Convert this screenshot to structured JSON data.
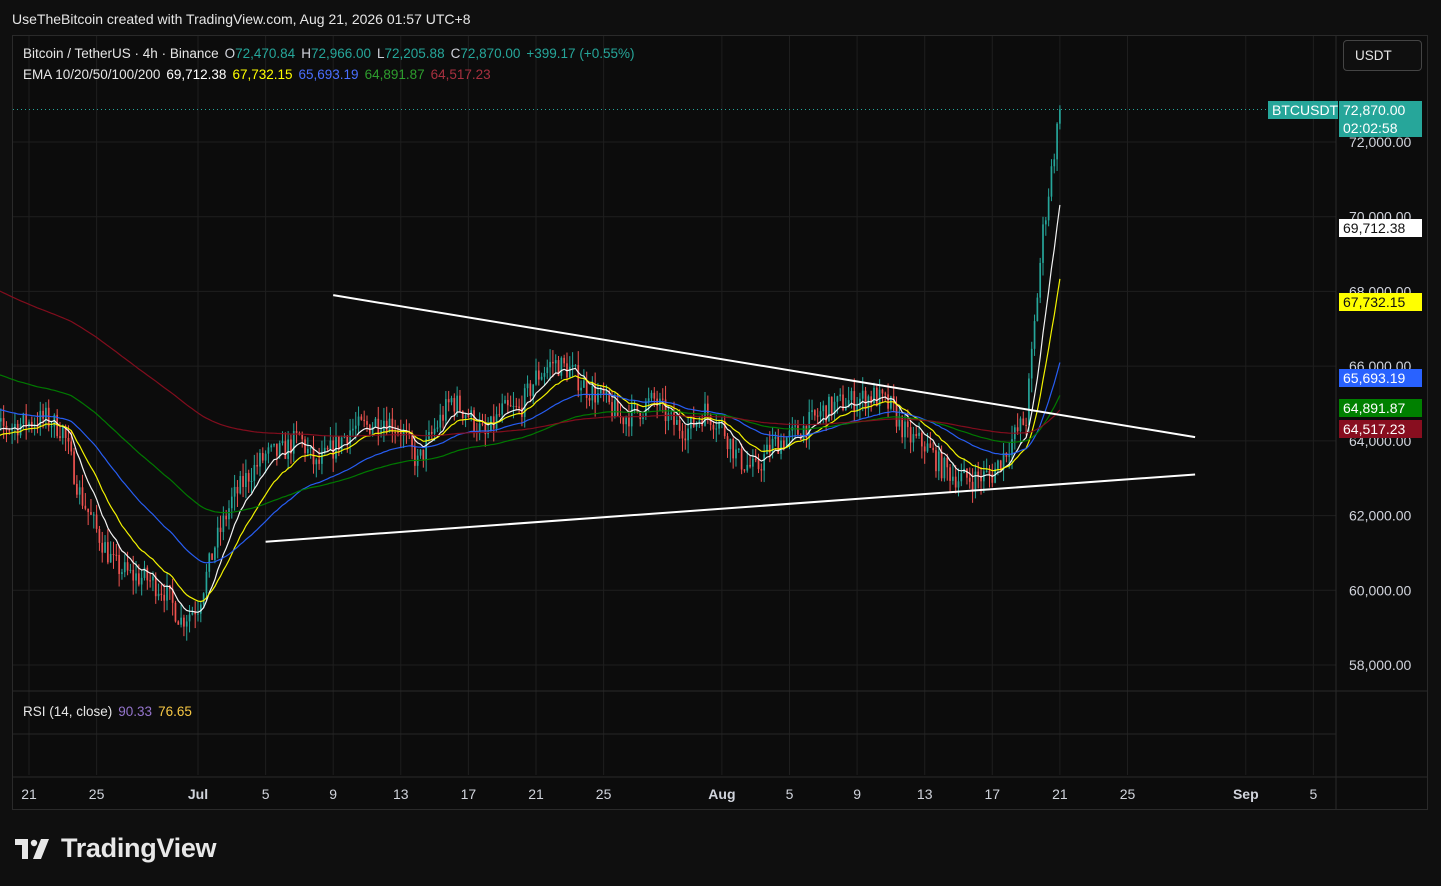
{
  "header": {
    "text": "UseTheBitcoin created with TradingView.com, Aug 21, 2026 01:57 UTC+8"
  },
  "legend": {
    "symbol": "Bitcoin / TetherUS · 4h · Binance",
    "o_label": "O",
    "o_value": "72,470.84",
    "h_label": "H",
    "h_value": "72,966.00",
    "l_label": "L",
    "l_value": "72,205.88",
    "c_label": "C",
    "c_value": "72,870.00",
    "change": "+399.17 (+0.55%)",
    "ema_label": "EMA 10/20/50/100/200",
    "ema_values": [
      "69,712.38",
      "67,732.15",
      "65,693.19",
      "64,891.87",
      "64,517.23"
    ],
    "rsi_label": "RSI (14, close)",
    "rsi_values": [
      "90.33",
      "76.65"
    ]
  },
  "currency_button": "USDT",
  "price_labels": {
    "ticker": "BTCUSDT",
    "last_price": "72,870.00",
    "countdown": "02:02:58",
    "ema10": "69,712.38",
    "ema20": "67,732.15",
    "ema50": "65,693.19",
    "ema100": "64,891.87",
    "ema200": "64,517.23"
  },
  "colors": {
    "background": "#0c0c0c",
    "grid": "#1e1e1e",
    "up": "#26a69a",
    "down": "#ef5350",
    "ema10": "#ffffff",
    "ema20": "#ffff00",
    "ema50": "#2962ff",
    "ema100": "#008000",
    "ema200": "#880e1f",
    "rsi": "#7e57c2",
    "rsi_ma": "#f7c844",
    "trendline": "#ffffff"
  },
  "chart_data": {
    "type": "candlestick",
    "interval": "4h",
    "symbol": "BTCUSDT",
    "y_ticks": [
      "72,000.00",
      "70,000.00",
      "68,000.00",
      "66,000.00",
      "64,000.00",
      "62,000.00",
      "60,000.00",
      "58,000.00"
    ],
    "ylim": [
      57000,
      73500
    ],
    "x_ticks": [
      "21",
      "25",
      "Jul",
      "5",
      "9",
      "13",
      "17",
      "21",
      "25",
      "Aug",
      "5",
      "9",
      "13",
      "17",
      "21",
      "25",
      "Sep",
      "5"
    ],
    "x_dates": [
      "2026-06-21",
      "2026-06-25",
      "2026-07-01",
      "2026-07-05",
      "2026-07-09",
      "2026-07-13",
      "2026-07-17",
      "2026-07-21",
      "2026-07-25",
      "2026-08-01",
      "2026-08-05",
      "2026-08-09",
      "2026-08-13",
      "2026-08-17",
      "2026-08-21",
      "2026-08-25",
      "2026-09-01",
      "2026-09-05"
    ],
    "close_path": [
      [
        "2026-06-18",
        64200
      ],
      [
        "2026-06-20",
        64400
      ],
      [
        "2026-06-22",
        64600
      ],
      [
        "2026-06-23",
        64300
      ],
      [
        "2026-06-24",
        62600
      ],
      [
        "2026-06-25",
        61600
      ],
      [
        "2026-06-26",
        60700
      ],
      [
        "2026-06-27",
        60400
      ],
      [
        "2026-06-28",
        60300
      ],
      [
        "2026-06-29",
        60000
      ],
      [
        "2026-06-30",
        59200
      ],
      [
        "2026-07-01",
        59600
      ],
      [
        "2026-07-02",
        61200
      ],
      [
        "2026-07-03",
        62400
      ],
      [
        "2026-07-04",
        63100
      ],
      [
        "2026-07-05",
        63600
      ],
      [
        "2026-07-06",
        63700
      ],
      [
        "2026-07-07",
        64100
      ],
      [
        "2026-07-08",
        63300
      ],
      [
        "2026-07-09",
        63800
      ],
      [
        "2026-07-10",
        64300
      ],
      [
        "2026-07-11",
        64400
      ],
      [
        "2026-07-12",
        64600
      ],
      [
        "2026-07-13",
        64300
      ],
      [
        "2026-07-14",
        63400
      ],
      [
        "2026-07-15",
        64300
      ],
      [
        "2026-07-16",
        65100
      ],
      [
        "2026-07-17",
        64700
      ],
      [
        "2026-07-18",
        64100
      ],
      [
        "2026-07-19",
        64800
      ],
      [
        "2026-07-20",
        64800
      ],
      [
        "2026-07-21",
        65700
      ],
      [
        "2026-07-22",
        66100
      ],
      [
        "2026-07-23",
        65900
      ],
      [
        "2026-07-24",
        65400
      ],
      [
        "2026-07-25",
        65100
      ],
      [
        "2026-07-26",
        64600
      ],
      [
        "2026-07-27",
        64800
      ],
      [
        "2026-07-28",
        65100
      ],
      [
        "2026-07-29",
        64500
      ],
      [
        "2026-07-30",
        64300
      ],
      [
        "2026-07-31",
        64800
      ],
      [
        "2026-08-01",
        64400
      ],
      [
        "2026-08-02",
        63500
      ],
      [
        "2026-08-03",
        63200
      ],
      [
        "2026-08-04",
        63900
      ],
      [
        "2026-08-05",
        64100
      ],
      [
        "2026-08-06",
        64400
      ],
      [
        "2026-08-07",
        64800
      ],
      [
        "2026-08-08",
        65000
      ],
      [
        "2026-08-09",
        65100
      ],
      [
        "2026-08-10",
        65200
      ],
      [
        "2026-08-11",
        64900
      ],
      [
        "2026-08-12",
        64100
      ],
      [
        "2026-08-13",
        63900
      ],
      [
        "2026-08-14",
        63300
      ],
      [
        "2026-08-15",
        63000
      ],
      [
        "2026-08-16",
        63000
      ],
      [
        "2026-08-17",
        63100
      ],
      [
        "2026-08-18",
        63900
      ],
      [
        "2026-08-19",
        64600
      ],
      [
        "2026-08-20",
        69600
      ],
      [
        "2026-08-21",
        72870
      ]
    ],
    "trendlines": [
      {
        "name": "upper-descending",
        "start": [
          "2026-07-09",
          67900
        ],
        "end": [
          "2026-08-29",
          64100
        ]
      },
      {
        "name": "lower-ascending",
        "start": [
          "2026-07-05",
          61300
        ],
        "end": [
          "2026-08-29",
          63100
        ]
      }
    ],
    "rsi": {
      "value": 90.33,
      "ma": 76.65
    },
    "grid": true
  }
}
